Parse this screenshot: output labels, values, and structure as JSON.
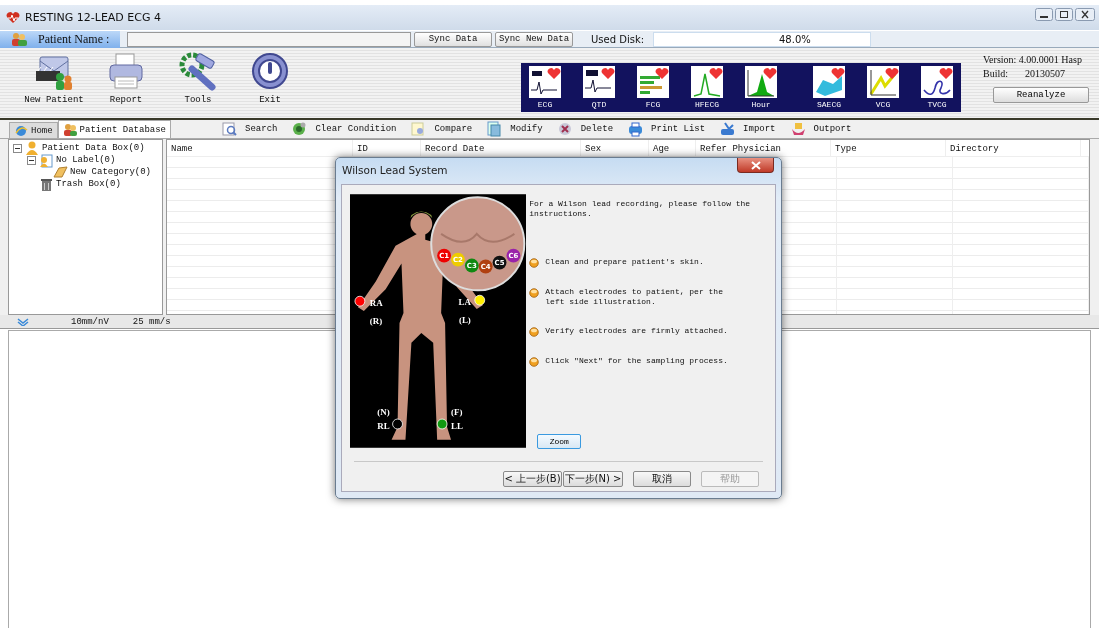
{
  "window": {
    "title": "RESTING 12-LEAD ECG 4"
  },
  "patient_bar": {
    "label": "Patient Name :",
    "buttons": [
      "Sync Data",
      "Sync New Data"
    ],
    "disk_label": "Used Disk:",
    "disk_reading": "48.0%"
  },
  "tools": [
    {
      "label": "New Patient",
      "kind": "patient"
    },
    {
      "label": "Report",
      "kind": "printer"
    },
    {
      "label": "Tools",
      "kind": "wrench"
    },
    {
      "label": "Exit",
      "kind": "power"
    }
  ],
  "modules": [
    {
      "label": "ECG",
      "kind": "ecg"
    },
    {
      "label": "QTD",
      "kind": "qtd"
    },
    {
      "label": "FCG",
      "kind": "bars"
    },
    {
      "label": "HFECG",
      "kind": "peak"
    },
    {
      "label": "Hour",
      "kind": "hill"
    },
    {
      "label": "SAECG",
      "kind": "surface"
    },
    {
      "label": "VCG",
      "kind": "vector"
    },
    {
      "label": "TVCG",
      "kind": "loop"
    }
  ],
  "version": {
    "version": "Version: 4.00.0001 Hasp",
    "build_label": "Build:",
    "build": "20130507",
    "button": "Reanalyze"
  },
  "tabs": [
    {
      "label": "Home",
      "selected": false
    },
    {
      "label": "Patient Database",
      "selected": true
    }
  ],
  "actions": [
    {
      "label": "Search",
      "kind": "search"
    },
    {
      "label": "Clear Condition",
      "kind": "clear"
    },
    {
      "label": "Compare",
      "kind": "compare"
    },
    {
      "label": "Modify",
      "kind": "modify"
    },
    {
      "label": "Delete",
      "kind": "delete"
    },
    {
      "label": "Print List",
      "kind": "print"
    },
    {
      "label": "Import",
      "kind": "import"
    },
    {
      "label": "Outport",
      "kind": "outport"
    }
  ],
  "tree": [
    {
      "label": "Patient Data Box(0)",
      "kind": "box",
      "expanded": true,
      "children": [
        {
          "label": "No Label(0)",
          "kind": "label",
          "expanded": true,
          "children": [
            {
              "label": "New Category(0)",
              "kind": "folder"
            }
          ]
        },
        {
          "label": "Trash Box(0)",
          "kind": "trash"
        }
      ]
    }
  ],
  "table": {
    "columns": [
      "Name",
      "ID",
      "Record Date",
      "Sex",
      "Age",
      "Refer Physician",
      "Type",
      "Directory"
    ]
  },
  "status": {
    "scale": "10mm/nV",
    "speed": "25 mm/s"
  },
  "dialog": {
    "title": "Wilson Lead System",
    "limb_electrodes": [
      {
        "lead": "RA",
        "alias": "(R)",
        "color": "#ff0000"
      },
      {
        "lead": "LA",
        "alias": "(L)",
        "color": "#ffee00"
      },
      {
        "lead": "RL",
        "alias": "(N)",
        "color": "#000000"
      },
      {
        "lead": "LL",
        "alias": "(F)",
        "color": "#119911"
      }
    ],
    "chest_electrodes": [
      {
        "label": "C1",
        "color": "#ee0000"
      },
      {
        "label": "C2",
        "color": "#eecc00"
      },
      {
        "label": "C3",
        "color": "#118811"
      },
      {
        "label": "C4",
        "color": "#b04010"
      },
      {
        "label": "C5",
        "color": "#111111"
      },
      {
        "label": "C6",
        "color": "#9922aa"
      }
    ],
    "intro": "For a Wilson lead recording, please follow the instructions.",
    "steps": [
      "Clean and prepare patient's skin.",
      "Attach electrodes to patient, per the left side illustration.",
      "Verify electrodes are firmly attached.",
      "Click \"Next\" for the sampling process."
    ],
    "zoom_button": "Zoom",
    "buttons": [
      {
        "label": "< 上一步(B)",
        "disabled": false
      },
      {
        "label": "下一步(N) >",
        "disabled": false
      },
      {
        "label": "取消",
        "disabled": false
      },
      {
        "label": "帮助",
        "disabled": true
      }
    ]
  }
}
